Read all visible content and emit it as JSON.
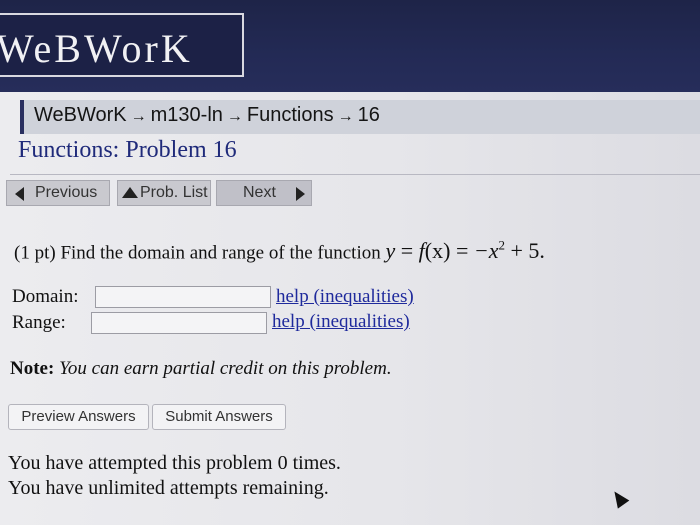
{
  "banner": {
    "logo_text": "WeBWorK"
  },
  "breadcrumb": {
    "items": [
      "WeBWorK",
      "m130-ln",
      "Functions",
      "16"
    ],
    "separator": "→"
  },
  "problem": {
    "title": "Functions: Problem 16",
    "points": "(1 pt)",
    "statement": "Find the domain and range of the function",
    "formula": {
      "lhs": "y",
      "equals": "=",
      "func": "f",
      "arg": "(x)",
      "rhs_prefix": "−x",
      "exponent": "2",
      "rhs_suffix": "+ 5."
    }
  },
  "nav": {
    "previous_label": "Previous",
    "prob_list_label": "Prob. List",
    "next_label": "Next"
  },
  "fields": {
    "domain_label": "Domain:",
    "range_label": "Range:",
    "domain_value": "",
    "range_value": "",
    "help_label": "help (inequalities)"
  },
  "note": {
    "bold": "Note:",
    "text": "You can earn partial credit on this problem."
  },
  "buttons": {
    "preview_label": "Preview Answers",
    "submit_label": "Submit Answers"
  },
  "attempts": {
    "line1": "You have attempted this problem 0 times.",
    "line2": "You have unlimited attempts remaining."
  },
  "colors": {
    "banner": "#232a55",
    "link": "#1f2a9c",
    "title": "#1f2a7a"
  }
}
